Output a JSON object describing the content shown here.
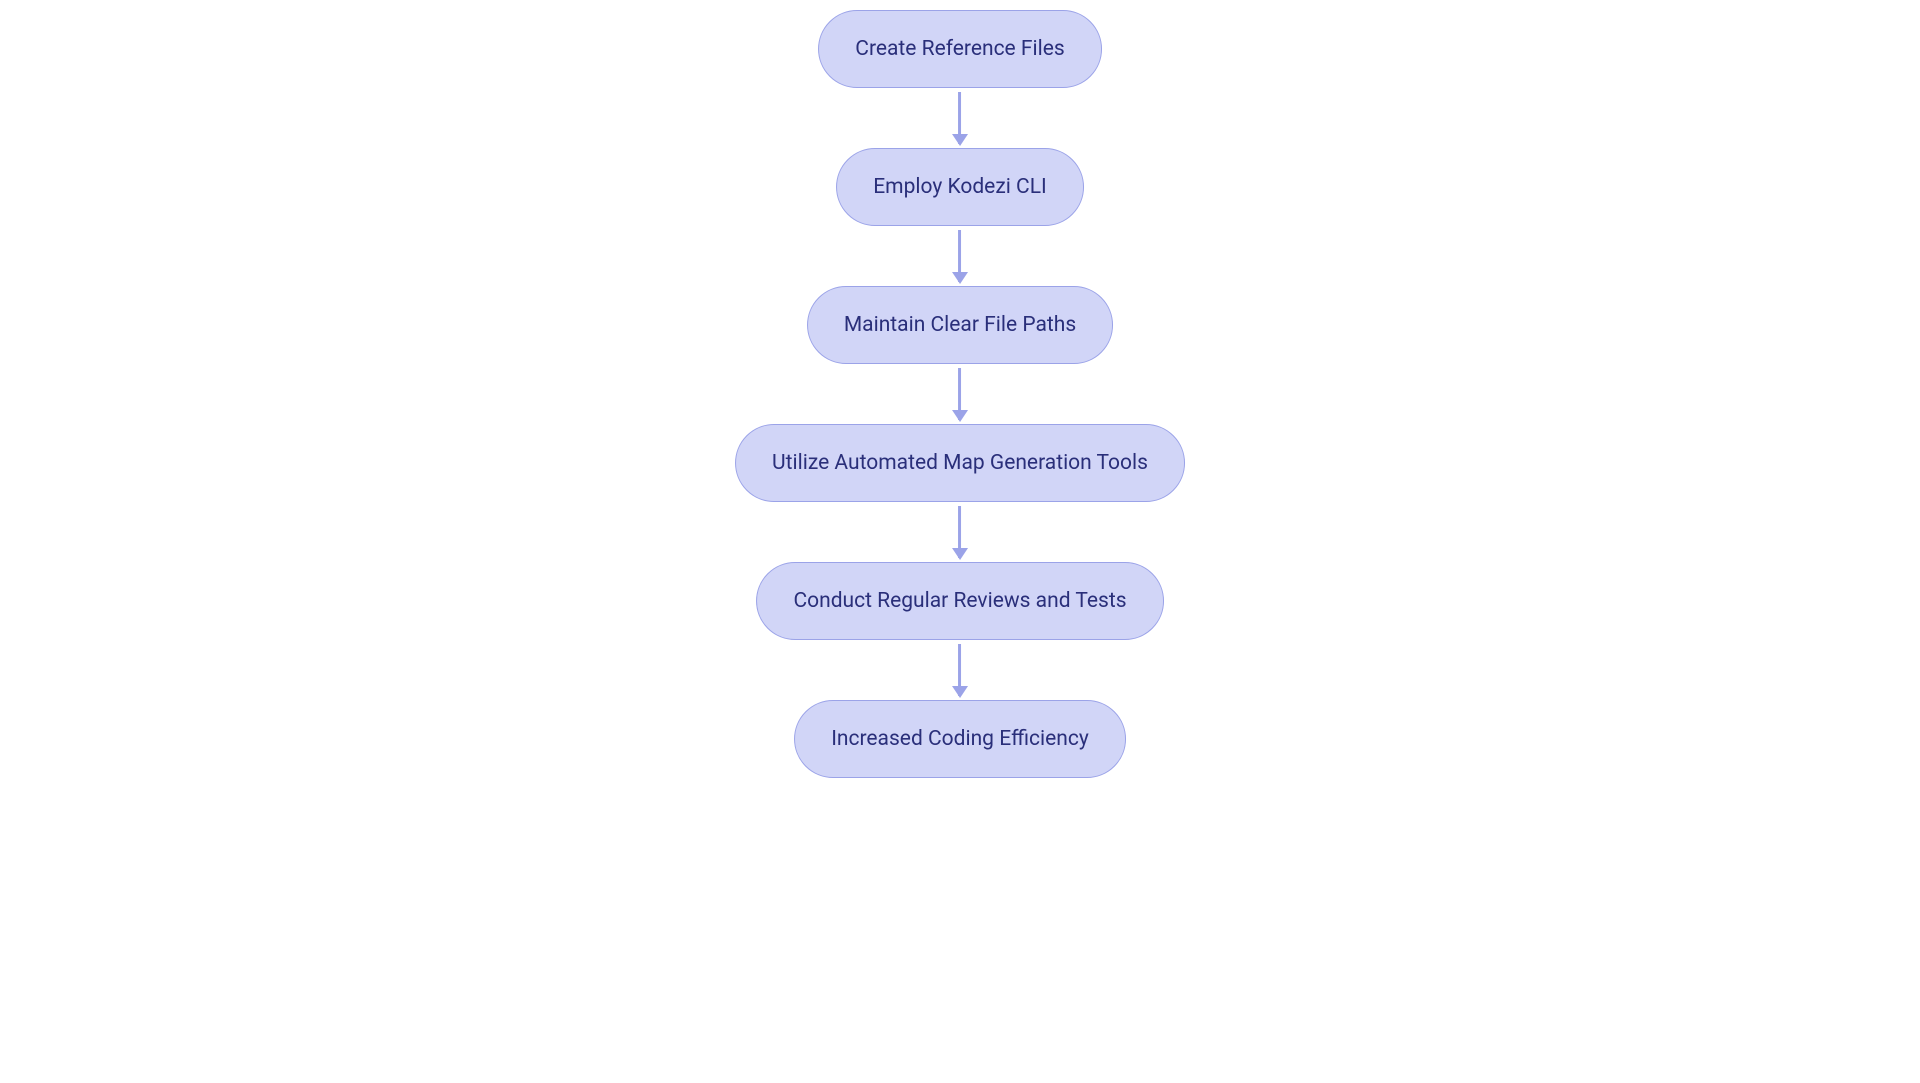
{
  "flowchart": {
    "nodes": [
      {
        "label": "Create Reference Files"
      },
      {
        "label": "Employ Kodezi CLI"
      },
      {
        "label": "Maintain Clear File Paths"
      },
      {
        "label": "Utilize Automated Map Generation Tools"
      },
      {
        "label": "Conduct Regular Reviews and Tests"
      },
      {
        "label": "Increased Coding Efficiency"
      }
    ]
  },
  "chart_data": {
    "type": "flowchart",
    "direction": "vertical",
    "nodes": [
      {
        "id": 1,
        "label": "Create Reference Files",
        "shape": "rounded-rectangle"
      },
      {
        "id": 2,
        "label": "Employ Kodezi CLI",
        "shape": "rounded-rectangle"
      },
      {
        "id": 3,
        "label": "Maintain Clear File Paths",
        "shape": "rounded-rectangle"
      },
      {
        "id": 4,
        "label": "Utilize Automated Map Generation Tools",
        "shape": "rounded-rectangle"
      },
      {
        "id": 5,
        "label": "Conduct Regular Reviews and Tests",
        "shape": "rounded-rectangle"
      },
      {
        "id": 6,
        "label": "Increased Coding Efficiency",
        "shape": "rounded-rectangle"
      }
    ],
    "edges": [
      {
        "from": 1,
        "to": 2
      },
      {
        "from": 2,
        "to": 3
      },
      {
        "from": 3,
        "to": 4
      },
      {
        "from": 4,
        "to": 5
      },
      {
        "from": 5,
        "to": 6
      }
    ],
    "colors": {
      "node_fill": "#d1d5f7",
      "node_border": "#9ba3e8",
      "node_text": "#2a2f7a",
      "arrow": "#9ba3e8"
    }
  }
}
